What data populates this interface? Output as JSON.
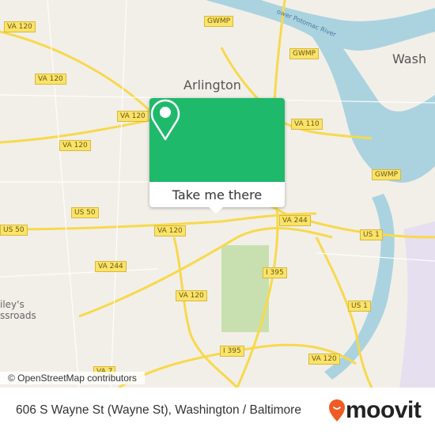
{
  "map": {
    "places": {
      "arlington": "Arlington",
      "washington": "Wash",
      "baileys_1": "iley's",
      "baileys_2": "ssroads"
    },
    "river_label": "ower Potomac River",
    "shields": [
      "VA 120",
      "VA 120",
      "VA 120",
      "VA 120",
      "VA 120",
      "VA 120",
      "GWMP",
      "GWMP",
      "GWMP",
      "VA 110",
      "VA 244",
      "VA 244",
      "US 50",
      "US 50",
      "US 1",
      "US 1",
      "I 395",
      "I 395",
      "VA 120",
      "VA 7"
    ],
    "attribution": "© OpenStreetMap contributors",
    "colors": {
      "land": "#f2efe9",
      "water": "#aad3df",
      "road": "#f7d94c",
      "park": "#c8e0b0"
    }
  },
  "popup": {
    "icon": "map-pin-icon",
    "cta": "Take me there",
    "color": "#1fb96b"
  },
  "footer": {
    "address": "606 S Wayne St (Wayne St), Washington / Baltimore",
    "brand": "moovit",
    "brand_color": "#ef5b25"
  }
}
